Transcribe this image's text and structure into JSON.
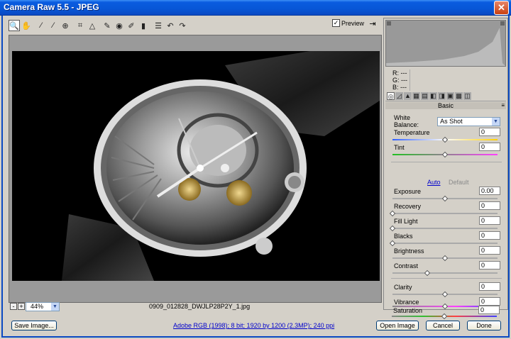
{
  "window": {
    "title": "Camera Raw 5.5  -  JPEG",
    "close_glyph": "✕"
  },
  "toolbar": {
    "tools": [
      {
        "name": "zoom-tool",
        "glyph": "🔍"
      },
      {
        "name": "hand-tool",
        "glyph": "✋"
      },
      {
        "name": "white-balance-tool",
        "glyph": "⁄"
      },
      {
        "name": "color-sampler-tool",
        "glyph": "⁄"
      },
      {
        "name": "targeted-adjustment-tool",
        "glyph": "⊕"
      },
      {
        "name": "crop-tool",
        "glyph": "⌗"
      },
      {
        "name": "straighten-tool",
        "glyph": "△"
      },
      {
        "name": "spot-removal-tool",
        "glyph": "✎"
      },
      {
        "name": "red-eye-tool",
        "glyph": "◉"
      },
      {
        "name": "adjustment-brush-tool",
        "glyph": "✐"
      },
      {
        "name": "graduated-filter-tool",
        "glyph": "▮"
      },
      {
        "name": "preferences-tool",
        "glyph": "☰"
      },
      {
        "name": "rotate-left-tool",
        "glyph": "↶"
      },
      {
        "name": "rotate-right-tool",
        "glyph": "↷"
      }
    ],
    "preview_label": "Preview",
    "preview_checked": true,
    "fullscreen_glyph": "⇥"
  },
  "canvas": {
    "zoom_minus": "-",
    "zoom_plus": "+",
    "zoom_value": "44%",
    "filename": "0909_012828_DWJLP28P2Y_1.jpg"
  },
  "panel": {
    "rgb": {
      "r": "R:  ---",
      "g": "G:  ---",
      "b": "B:  ---"
    },
    "tabs": [
      "◎",
      "◿",
      "▲",
      "▦",
      "▤",
      "◧",
      "◨",
      "▣",
      "▩",
      "◫"
    ],
    "header": "Basic",
    "header_menu": "≡",
    "white_balance_label": "White Balance:",
    "white_balance_value": "As Shot",
    "auto_label": "Auto",
    "default_label": "Default",
    "sliders": {
      "temperature": {
        "label": "Temperature",
        "value": "0",
        "pos": 0.5
      },
      "tint": {
        "label": "Tint",
        "value": "0",
        "pos": 0.5
      },
      "exposure": {
        "label": "Exposure",
        "value": "0.00",
        "pos": 0.5
      },
      "recovery": {
        "label": "Recovery",
        "value": "0",
        "pos": 0.0
      },
      "fill_light": {
        "label": "Fill Light",
        "value": "0",
        "pos": 0.0
      },
      "blacks": {
        "label": "Blacks",
        "value": "0",
        "pos": 0.0
      },
      "brightness": {
        "label": "Brightness",
        "value": "0",
        "pos": 0.5
      },
      "contrast": {
        "label": "Contrast",
        "value": "0",
        "pos": 0.33
      },
      "clarity": {
        "label": "Clarity",
        "value": "0",
        "pos": 0.5
      },
      "vibrance": {
        "label": "Vibrance",
        "value": "0",
        "pos": 0.5
      },
      "saturation": {
        "label": "Saturation",
        "value": "0",
        "pos": 0.5
      }
    }
  },
  "footer": {
    "save_label": "Save Image...",
    "workflow_text": "Adobe RGB (1998); 8 bit; 1920 by 1200 (2.3MP); 240 ppi",
    "open_label": "Open Image",
    "cancel_label": "Cancel",
    "done_label": "Done"
  },
  "colors": {
    "titlebar": "#0756d6",
    "link": "#0000cc"
  }
}
